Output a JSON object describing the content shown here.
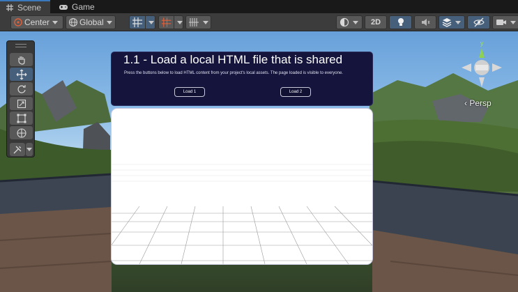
{
  "tabs": [
    {
      "label": "Scene",
      "icon": "hash-grid-icon"
    },
    {
      "label": "Game",
      "icon": "gamepad-icon"
    }
  ],
  "toolbar": {
    "pivot_mode": "Center",
    "pivot_rotation": "Global",
    "mode_2d": "2D"
  },
  "scene": {
    "projection": "Persp",
    "axis_y": "y"
  },
  "panel": {
    "title": "1.1 - Load a local HTML file that is shared",
    "description": "Press the buttons below to load HTML content from your project's local assets. The page loaded is visible to everyone.",
    "button1": "Load 1",
    "button2": "Load 2"
  },
  "colors": {
    "accent": "#3a79bb",
    "active_tool": "#46607c",
    "panel_bg": "#14143c"
  }
}
